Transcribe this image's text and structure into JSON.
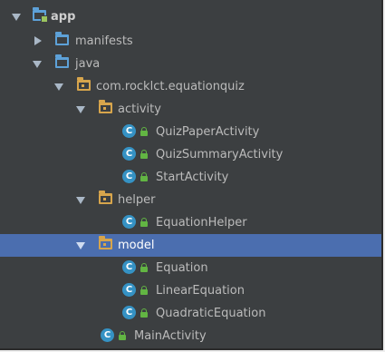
{
  "tree": {
    "app": {
      "label": "app",
      "icon": "module-folder-icon"
    },
    "manifests": {
      "label": "manifests",
      "icon": "folder-icon"
    },
    "java": {
      "label": "java",
      "icon": "folder-icon"
    },
    "root_package": {
      "label": "com.rocklct.equationquiz",
      "icon": "package-icon"
    },
    "activity": {
      "label": "activity",
      "icon": "package-icon",
      "classes": [
        "QuizPaperActivity",
        "QuizSummaryActivity",
        "StartActivity"
      ]
    },
    "helper": {
      "label": "helper",
      "icon": "package-icon",
      "classes": [
        "EquationHelper"
      ]
    },
    "model": {
      "label": "model",
      "icon": "package-icon",
      "classes": [
        "Equation",
        "LinearEquation",
        "QuadraticEquation"
      ]
    },
    "main_activity": {
      "label": "MainActivity"
    },
    "class_icon_letter": "C"
  },
  "colors": {
    "background": "#3c3f41",
    "selection": "#4b6eaf",
    "folder": "#5da1d8",
    "package": "#d7a54c",
    "class_icon": "#3592c4",
    "lock": "#62b543"
  }
}
